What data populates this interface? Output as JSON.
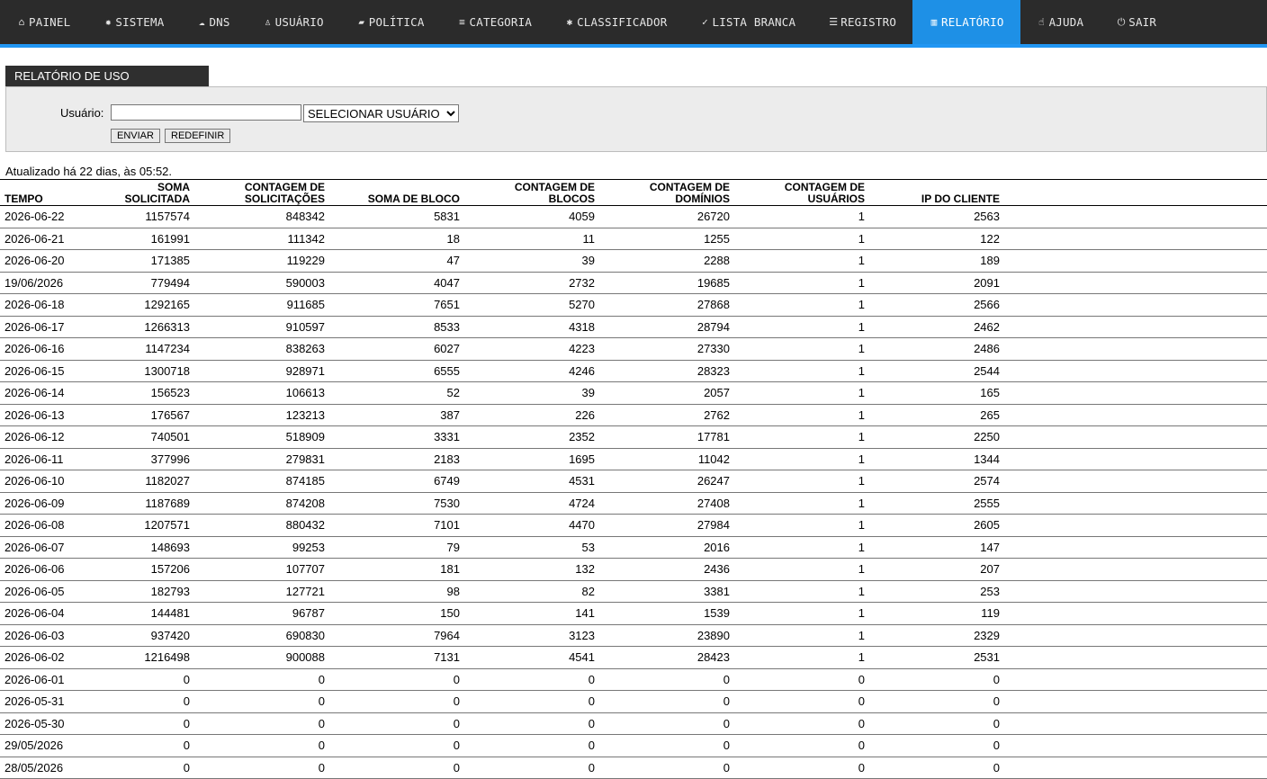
{
  "nav": [
    {
      "id": "painel",
      "icon": "home-icon",
      "glyph": "⌂",
      "label": "PAINEL"
    },
    {
      "id": "sistema",
      "icon": "gear-icon",
      "glyph": "✹",
      "label": "SISTEMA"
    },
    {
      "id": "dns",
      "icon": "cloud-icon",
      "glyph": "☁",
      "label": "DNS"
    },
    {
      "id": "usuario",
      "icon": "user-icon",
      "glyph": "♙",
      "label": "USUÁRIO"
    },
    {
      "id": "politica",
      "icon": "book-icon",
      "glyph": "▰",
      "label": "POLÍTICA"
    },
    {
      "id": "categoria",
      "icon": "list-icon",
      "glyph": "≡",
      "label": "CATEGORIA"
    },
    {
      "id": "classificador",
      "icon": "bug-icon",
      "glyph": "✱",
      "label": "CLASSIFICADOR"
    },
    {
      "id": "lista-branca",
      "icon": "check-circle-icon",
      "glyph": "✓",
      "label": "LISTA BRANCA"
    },
    {
      "id": "registro",
      "icon": "database-icon",
      "glyph": "☰",
      "label": "REGISTRO"
    },
    {
      "id": "relatorio",
      "icon": "bar-chart-icon",
      "glyph": "▥",
      "label": "RELATÓRIO",
      "active": true
    },
    {
      "id": "ajuda",
      "icon": "hand-icon",
      "glyph": "☝",
      "label": "AJUDA"
    },
    {
      "id": "sair",
      "icon": "power-icon",
      "glyph": "⏻",
      "label": "SAIR"
    }
  ],
  "panel": {
    "title": "RELATÓRIO DE USO",
    "user_label": "Usuário:",
    "user_value": "",
    "select_value": "SELECIONAR USUÁRIO",
    "send": "ENVIAR",
    "reset": "REDEFINIR"
  },
  "updated": "Atualizado há 22 dias, às 05:52.",
  "table": {
    "headers": [
      "TEMPO",
      "SOMA SOLICITADA",
      "CONTAGEM DE SOLICITAÇÕES",
      "SOMA DE BLOCO",
      "CONTAGEM DE BLOCOS",
      "CONTAGEM DE DOMÍNIOS",
      "CONTAGEM DE USUÁRIOS",
      "IP DO CLIENTE"
    ],
    "rows": [
      [
        "2026-06-22",
        "1157574",
        "848342",
        "5831",
        "4059",
        "26720",
        "1",
        "2563"
      ],
      [
        "2026-06-21",
        "161991",
        "111342",
        "18",
        "11",
        "1255",
        "1",
        "122"
      ],
      [
        "2026-06-20",
        "171385",
        "119229",
        "47",
        "39",
        "2288",
        "1",
        "189"
      ],
      [
        "19/06/2026",
        "779494",
        "590003",
        "4047",
        "2732",
        "19685",
        "1",
        "2091"
      ],
      [
        "2026-06-18",
        "1292165",
        "911685",
        "7651",
        "5270",
        "27868",
        "1",
        "2566"
      ],
      [
        "2026-06-17",
        "1266313",
        "910597",
        "8533",
        "4318",
        "28794",
        "1",
        "2462"
      ],
      [
        "2026-06-16",
        "1147234",
        "838263",
        "6027",
        "4223",
        "27330",
        "1",
        "2486"
      ],
      [
        "2026-06-15",
        "1300718",
        "928971",
        "6555",
        "4246",
        "28323",
        "1",
        "2544"
      ],
      [
        "2026-06-14",
        "156523",
        "106613",
        "52",
        "39",
        "2057",
        "1",
        "165"
      ],
      [
        "2026-06-13",
        "176567",
        "123213",
        "387",
        "226",
        "2762",
        "1",
        "265"
      ],
      [
        "2026-06-12",
        "740501",
        "518909",
        "3331",
        "2352",
        "17781",
        "1",
        "2250"
      ],
      [
        "2026-06-11",
        "377996",
        "279831",
        "2183",
        "1695",
        "11042",
        "1",
        "1344"
      ],
      [
        "2026-06-10",
        "1182027",
        "874185",
        "6749",
        "4531",
        "26247",
        "1",
        "2574"
      ],
      [
        "2026-06-09",
        "1187689",
        "874208",
        "7530",
        "4724",
        "27408",
        "1",
        "2555"
      ],
      [
        "2026-06-08",
        "1207571",
        "880432",
        "7101",
        "4470",
        "27984",
        "1",
        "2605"
      ],
      [
        "2026-06-07",
        "148693",
        "99253",
        "79",
        "53",
        "2016",
        "1",
        "147"
      ],
      [
        "2026-06-06",
        "157206",
        "107707",
        "181",
        "132",
        "2436",
        "1",
        "207"
      ],
      [
        "2026-06-05",
        "182793",
        "127721",
        "98",
        "82",
        "3381",
        "1",
        "253"
      ],
      [
        "2026-06-04",
        "144481",
        "96787",
        "150",
        "141",
        "1539",
        "1",
        "119"
      ],
      [
        "2026-06-03",
        "937420",
        "690830",
        "7964",
        "3123",
        "23890",
        "1",
        "2329"
      ],
      [
        "2026-06-02",
        "1216498",
        "900088",
        "7131",
        "4541",
        "28423",
        "1",
        "2531"
      ],
      [
        "2026-06-01",
        "0",
        "0",
        "0",
        "0",
        "0",
        "0",
        "0"
      ],
      [
        "2026-05-31",
        "0",
        "0",
        "0",
        "0",
        "0",
        "0",
        "0"
      ],
      [
        "2026-05-30",
        "0",
        "0",
        "0",
        "0",
        "0",
        "0",
        "0"
      ],
      [
        "29/05/2026",
        "0",
        "0",
        "0",
        "0",
        "0",
        "0",
        "0"
      ],
      [
        "28/05/2026",
        "0",
        "0",
        "0",
        "0",
        "0",
        "0",
        "0"
      ]
    ]
  }
}
